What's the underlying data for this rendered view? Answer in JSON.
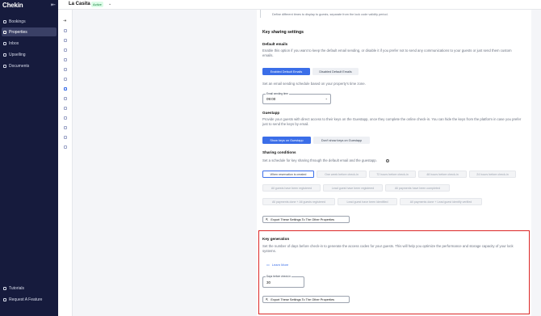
{
  "app": {
    "logo": "Chekin",
    "collapse_icon": "collapse-icon"
  },
  "sidebar": {
    "items": [
      {
        "label": "Bookings",
        "icon": "calendar-icon"
      },
      {
        "label": "Properties",
        "icon": "home-icon",
        "active": true
      },
      {
        "label": "Inbox",
        "icon": "inbox-icon"
      },
      {
        "label": "Upselling",
        "icon": "upselling-icon"
      },
      {
        "label": "Documents",
        "icon": "document-icon"
      }
    ],
    "bottom": [
      {
        "label": "Tutorials",
        "icon": "lightbulb-icon"
      },
      {
        "label": "Request A Feature",
        "icon": "feature-icon"
      }
    ]
  },
  "header": {
    "property_name": "La Casita",
    "status_badge": "Active"
  },
  "section_top": {
    "note": "Define different times to display to guests, separate from the lock code validity period."
  },
  "key_sharing": {
    "title": "Key sharing settings",
    "default_emails": {
      "title": "Default emails",
      "description": "Enable this option if you want to keep the default email sending, or disable it if you prefer not to send any communications to your guests or just send them custom emails.",
      "enable_label": "Enabled Default Emails",
      "disable_label": "Disabled Default Emails",
      "schedule_text": "Set an email sending schedule based on your property's time zone.",
      "sending_time_label": "Email sending time",
      "sending_time_value": "09:00"
    },
    "guestapp": {
      "title": "Guestapp",
      "description": "Provide your guests with direct access to their keys on the Guestapp, once they complete the online check-in. You can hide the keys from the platform in case you prefer just to send the keys by email.",
      "show_label": "Show keys on Guestapp",
      "hide_label": "Don't show keys on Guestapp"
    },
    "conditions": {
      "title": "Sharing conditions",
      "description": "Set a schedule for key sharing through the default email and the guestapp.",
      "chips": [
        "When reservation is created",
        "One week before check-in",
        "72 hours before check-in",
        "48 hours before check-in",
        "24 hours before check-in",
        "All guests have been registered",
        "Lead guest have been registered",
        "All payments have been completed",
        "All payments done + All guests registered",
        "Lead guest have been identified",
        "All payments done + Lead guest identify verified"
      ],
      "selected_index": 0
    },
    "export_label": "Export These Settings To The Other Properties"
  },
  "key_generation": {
    "title": "Key generation",
    "description": "Set the number of days before check-in to generate the access codes for your guests. This will help you optimize the performance and storage capacity of your lock systems.",
    "learn_more": "Learn More",
    "days_label": "Days before check-in",
    "days_value": "30",
    "export_label": "Export These Settings To The Other Properties"
  },
  "colors": {
    "primary": "#3b6ee8",
    "sidebar_bg": "#161b3d",
    "highlight": "#dc2626"
  }
}
